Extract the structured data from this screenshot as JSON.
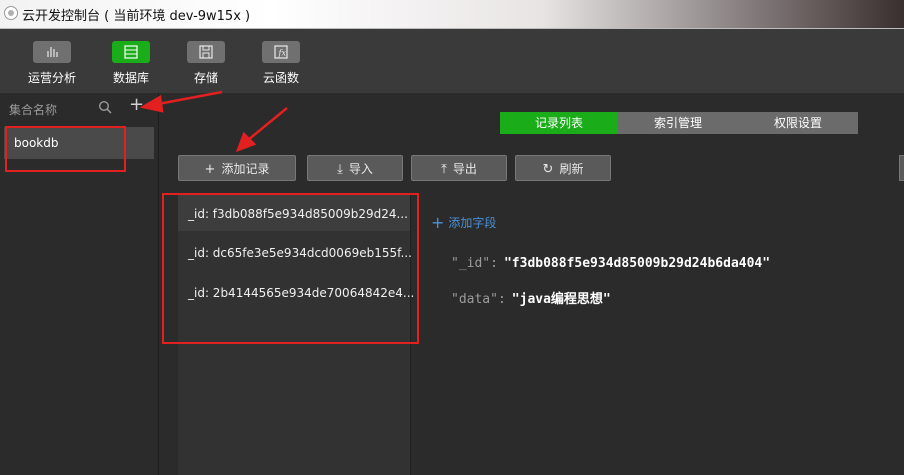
{
  "window": {
    "title": "云开发控制台 ( 当前环境 dev-9w15x )"
  },
  "toolbar": {
    "items": [
      {
        "label": "运营分析",
        "icon": "chart-icon",
        "active": false
      },
      {
        "label": "数据库",
        "icon": "database-icon",
        "active": true
      },
      {
        "label": "存储",
        "icon": "save-icon",
        "active": false
      },
      {
        "label": "云函数",
        "icon": "function-icon",
        "active": false
      }
    ]
  },
  "sidebar": {
    "header_label": "集合名称",
    "collections": [
      {
        "name": "bookdb",
        "selected": true
      }
    ]
  },
  "tabs": [
    {
      "label": "记录列表",
      "active": true
    },
    {
      "label": "索引管理",
      "active": false
    },
    {
      "label": "权限设置",
      "active": false
    }
  ],
  "actions": {
    "add": "添加记录",
    "import": "导入",
    "export": "导出",
    "refresh": "刷新"
  },
  "records": [
    "_id: f3db088f5e934d85009b29d24...",
    "_id: dc65fe3e5e934dcd0069eb155f...",
    "_id: 2b4144565e934de70064842e4..."
  ],
  "detail": {
    "add_field": "添加字段",
    "fields": [
      {
        "key": "\"_id\":",
        "value": "\"f3db088f5e934d85009b29d24b6da404\""
      },
      {
        "key": "\"data\":",
        "value": "\"java编程思想\""
      }
    ]
  },
  "colors": {
    "accent": "#1aad19",
    "annotation": "#e32020",
    "link": "#4a90d9"
  }
}
